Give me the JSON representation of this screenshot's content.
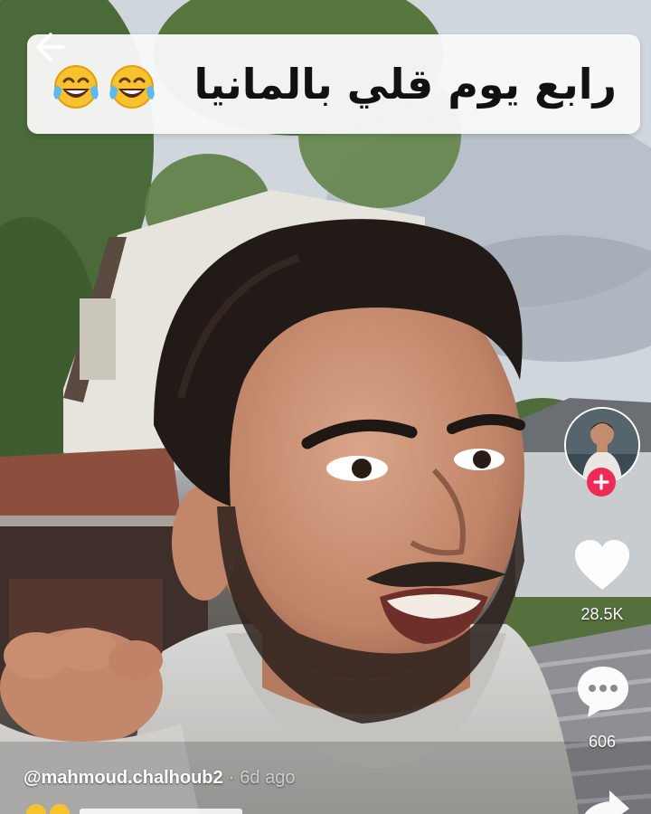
{
  "caption": {
    "text": "رابع يوم قلي بالمانيا",
    "emoji": "face-with-tears-of-joy"
  },
  "nav": {
    "back_icon": "arrow-left-icon"
  },
  "creator": {
    "username": "@mahmoud.chalhoub2",
    "separator": "·",
    "post_age": "6d ago"
  },
  "actions": {
    "likes": "28.5K",
    "comments": "606",
    "follow_icon": "plus-icon",
    "like_icon": "heart-icon",
    "comment_icon": "comment-bubble-icon",
    "share_icon": "share-arrow-icon"
  },
  "colors": {
    "follow_accent": "#ee2a55",
    "banner_background": "#f8f8f8",
    "overlay_text": "#ffffff"
  }
}
